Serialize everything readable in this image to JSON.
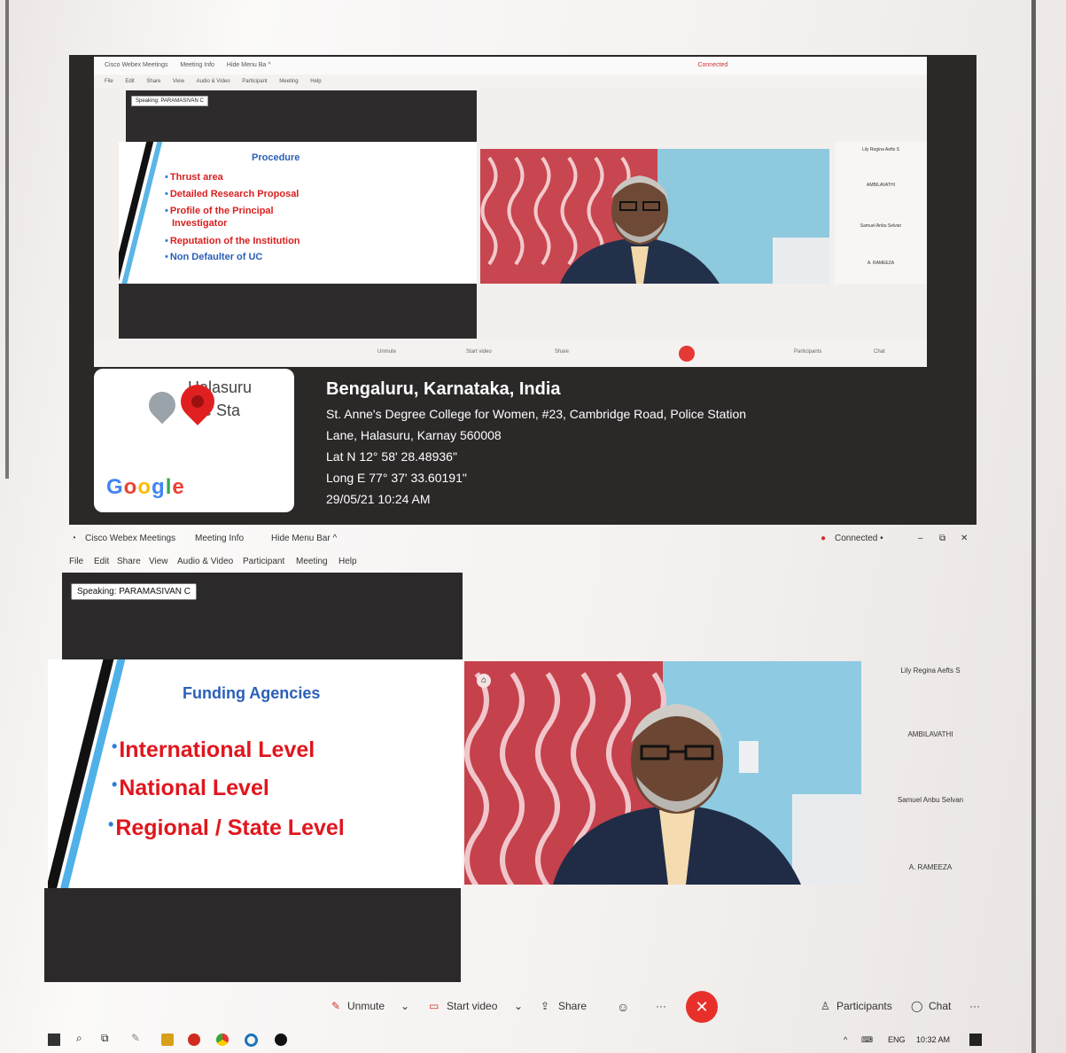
{
  "top_screen": {
    "titlebar": {
      "app_name": "Cisco Webex Meetings",
      "meeting_info": "Meeting Info",
      "hide_menu": "Hide Menu Ba ^",
      "status": "Connected"
    },
    "menubar": [
      "File",
      "Edit",
      "Share",
      "View",
      "Audio & Video",
      "Participant",
      "Meeting",
      "Help"
    ],
    "speaking": "Speaking: PARAMASIVAN C",
    "slide": {
      "title": "Procedure",
      "bullets": [
        "Thrust area",
        "Detailed Research Proposal",
        "Profile of the Principal",
        "Investigator",
        "Reputation of the Institution",
        "Non Defaulter of UC"
      ]
    },
    "participants": [
      "Lily Regina Aefts S",
      "AMBILAVATHI",
      "Samuel Anbu Selvan",
      "A. RAMEEZA"
    ],
    "toolbar": {
      "unmute": "Unmute",
      "start_video": "Start video",
      "share": "Share",
      "participants": "Participants",
      "chat": "Chat"
    }
  },
  "geo_tag": {
    "map_text_1": "Halasuru",
    "map_text_2": "lice Sta",
    "google": "Google",
    "google_colors": [
      "#4285F4",
      "#EA4335",
      "#FBBC05",
      "#4285F4",
      "#34A853",
      "#EA4335"
    ],
    "city": "Bengaluru, Karnataka, India",
    "address_1": "St. Anne's Degree College for Women, #23, Cambridge Road, Police Station",
    "address_2": "Lane, Halasuru, Karnay 560008",
    "lat": "Lat N 12° 58' 28.48936\"",
    "long": "Long E 77° 37' 33.60191\"",
    "datetime": "29/05/21 10:24 AM"
  },
  "bottom_screen": {
    "titlebar": {
      "app_name": "Cisco Webex Meetings",
      "meeting_info": "Meeting Info",
      "hide_menu": "Hide Menu Bar ^",
      "status": "Connected •",
      "minimize": "–",
      "restore": "⧉",
      "close": "✕"
    },
    "menubar": [
      "File",
      "Edit",
      "Share",
      "View",
      "Audio & Video",
      "Participant",
      "Meeting",
      "Help"
    ],
    "speaking": "Speaking: PARAMASIVAN C",
    "slide": {
      "title": "Funding Agencies",
      "bullets": [
        "International Level",
        "National Level",
        "Regional / State Level"
      ]
    },
    "participants": [
      "Lily Regina Aefts S",
      "AMBILAVATHI",
      "Samuel Anbu Selvan",
      "A. RAMEEZA"
    ],
    "toolbar": {
      "unmute": "Unmute",
      "start_video": "Start video",
      "share": "Share",
      "emoji": "☺",
      "more": "···",
      "end": "✕",
      "participants": "Participants",
      "chat": "Chat",
      "overflow": "···"
    },
    "accent_red": "#e8302a"
  },
  "taskbar": {
    "lang": "ENG",
    "time": "10:32 AM"
  }
}
